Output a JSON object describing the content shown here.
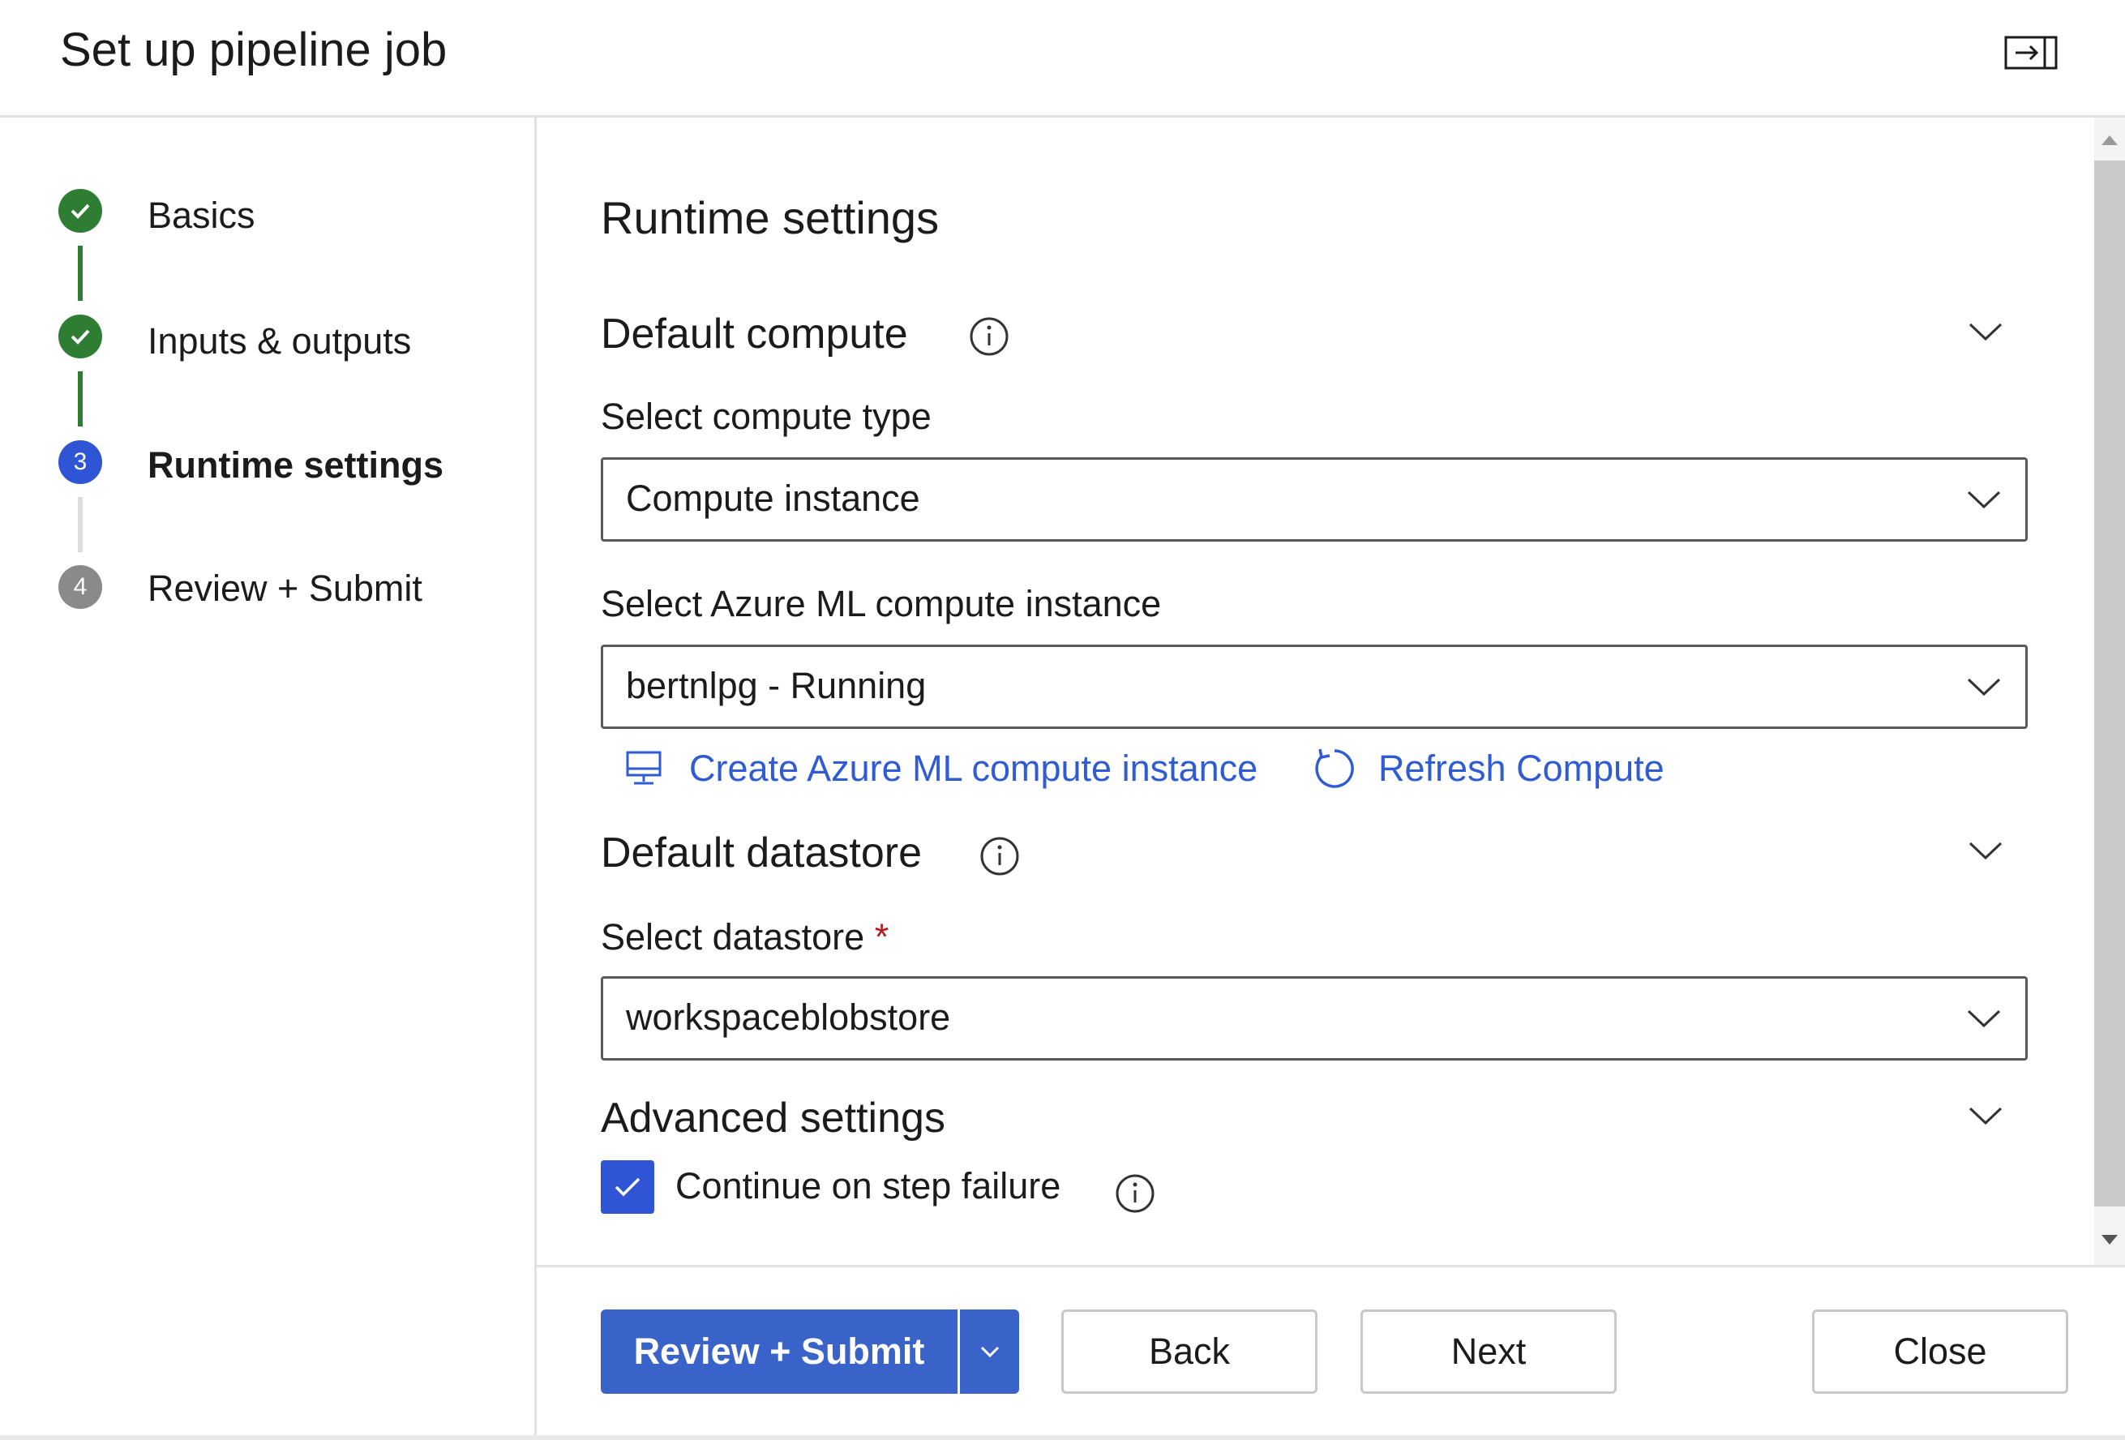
{
  "header": {
    "title": "Set up pipeline job",
    "collapse_icon": "collapse-panel-icon"
  },
  "steps": [
    {
      "label": "Basics",
      "status": "completed",
      "marker": ""
    },
    {
      "label": "Inputs & outputs",
      "status": "completed",
      "marker": ""
    },
    {
      "label": "Runtime settings",
      "status": "current",
      "marker": "3"
    },
    {
      "label": "Review + Submit",
      "status": "upcoming",
      "marker": "4"
    }
  ],
  "main": {
    "heading": "Runtime settings",
    "default_compute": {
      "title": "Default compute",
      "compute_type_label": "Select compute type",
      "compute_type_value": "Compute instance",
      "instance_label": "Select Azure ML compute instance",
      "instance_value": "bertnlpg - Running",
      "create_link": "Create Azure ML compute instance",
      "refresh_link": "Refresh Compute"
    },
    "default_datastore": {
      "title": "Default datastore",
      "datastore_label": "Select datastore",
      "required_marker": "*",
      "datastore_value": "workspaceblobstore"
    },
    "advanced_settings": {
      "title": "Advanced settings",
      "continue_on_failure_label": "Continue on step failure",
      "continue_on_failure_checked": true
    }
  },
  "footer": {
    "review_submit": "Review + Submit",
    "back": "Back",
    "next": "Next",
    "close": "Close"
  },
  "colors": {
    "accent": "#2f54d6",
    "primary_button": "#3a63c9",
    "link": "#2f5bd3",
    "completed": "#2e7d32",
    "required": "#b02020"
  }
}
